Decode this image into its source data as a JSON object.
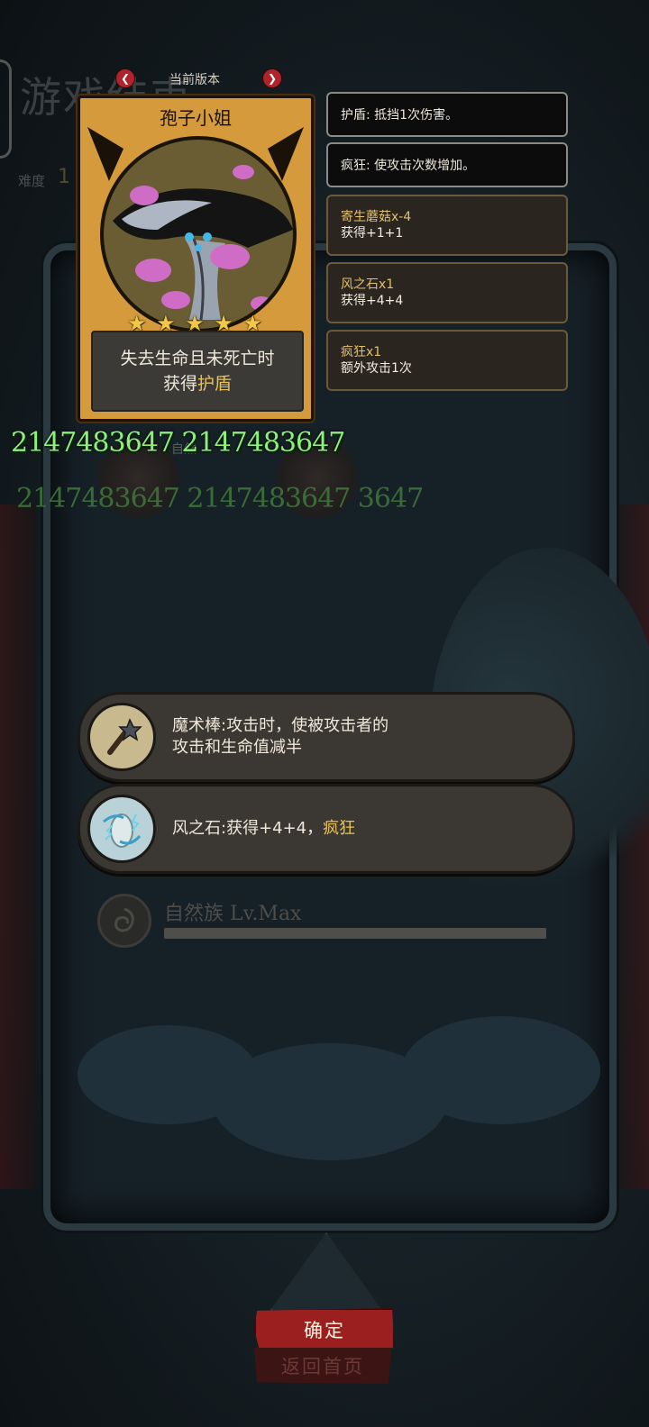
{
  "background": {
    "title": "游戏结束",
    "difficulty_label": "难度",
    "difficulty_value": "1"
  },
  "version_nav": {
    "label": "当前版本",
    "prev_icon": "chevron-left-icon",
    "next_icon": "chevron-right-icon"
  },
  "card": {
    "name": "孢子小姐",
    "stars": 5,
    "star_glyphs": [
      "★",
      "★",
      "★",
      "★",
      "★"
    ],
    "desc_line1": "失去生命且未死亡时",
    "desc_line2_prefix": "获得",
    "desc_line2_highlight": "护盾"
  },
  "info_boxes": {
    "shield": "护盾: 抵挡1次伤害。",
    "frenzy": "疯狂: 使攻击次数增加。",
    "items": [
      {
        "title": "寄生蘑菇x-4",
        "desc": "获得+1+1"
      },
      {
        "title": "风之石x1",
        "desc": "获得+4+4"
      },
      {
        "title": "疯狂x1",
        "desc": "额外攻击1次"
      }
    ]
  },
  "stats": {
    "bright_line": "2147483647 2147483647",
    "dim_line": "2147483647 2147483647 3647",
    "ghost_label": "自然"
  },
  "skills": [
    {
      "icon": "magic-wand-icon",
      "line1": "魔术棒:攻击时，使被攻击者的",
      "line2": "攻击和生命值减半"
    },
    {
      "icon": "wind-stone-icon",
      "prefix": "风之石:获得+4+4，",
      "highlight": "疯狂"
    }
  ],
  "tribe": {
    "icon": "nature-tribe-icon",
    "label": "自然族 Lv.Max",
    "progress": 1.0
  },
  "buttons": {
    "confirm": "确定",
    "home": "返回首页"
  },
  "colors": {
    "highlight": "#e9c255",
    "number_green": "#8ef07c",
    "confirm_red": "#9c1f1f"
  }
}
